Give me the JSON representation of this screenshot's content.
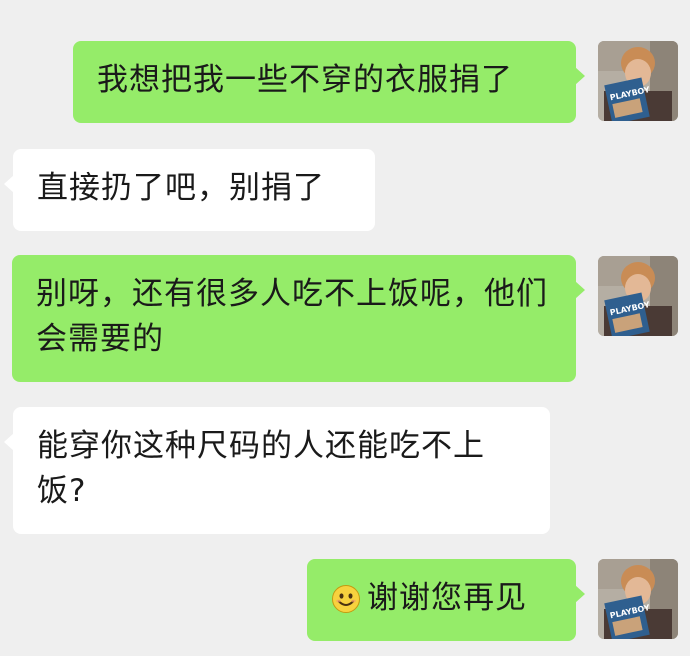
{
  "conversation": {
    "messages": [
      {
        "side": "sent",
        "text": "我想把我一些不穿的衣服捐了"
      },
      {
        "side": "received",
        "text": "直接扔了吧，别捐了"
      },
      {
        "side": "sent",
        "text": "别呀，还有很多人吃不上饭呢，他们会需要的"
      },
      {
        "side": "received",
        "text": "能穿你这种尺码的人还能吃不上饭?"
      },
      {
        "side": "sent",
        "emoji": "smiley-emoji",
        "text": "谢谢您再见"
      }
    ],
    "avatar_magazine_text": "PLAYBOY"
  },
  "colors": {
    "background": "#efefef",
    "sent_bubble": "#95ec69",
    "received_bubble": "#ffffff",
    "emoji_face": "#f7d23e"
  }
}
